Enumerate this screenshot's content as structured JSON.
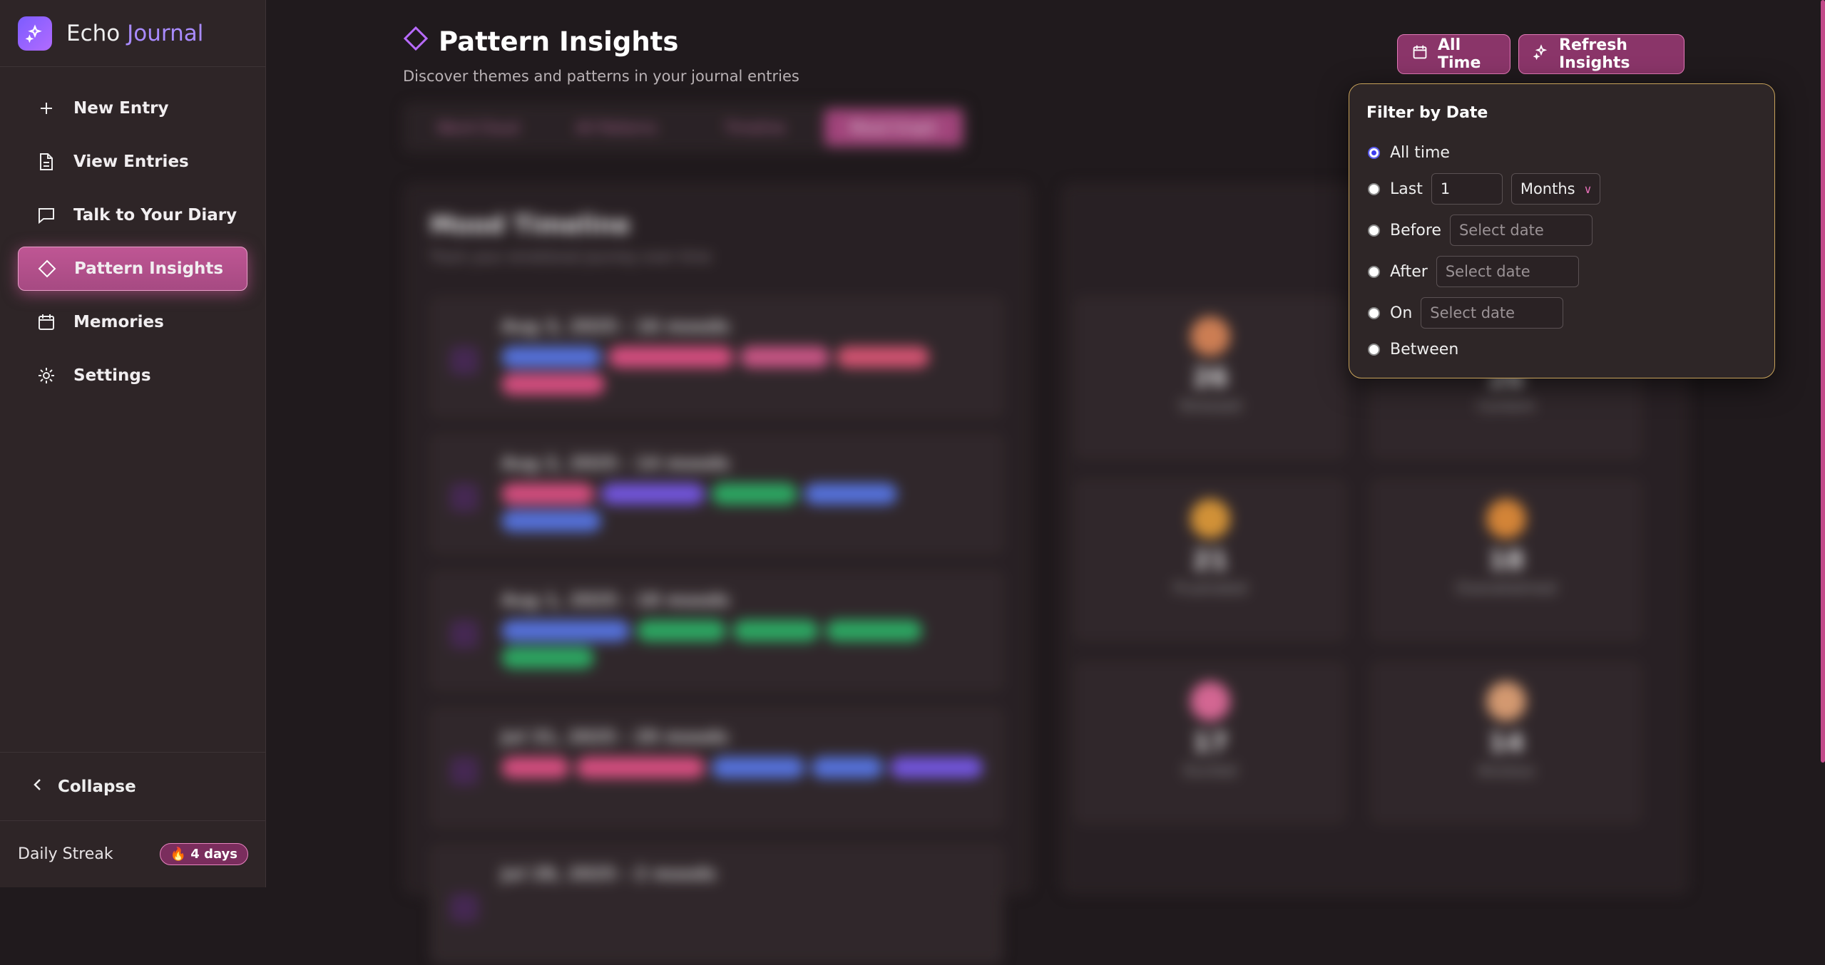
{
  "brand": {
    "name_part1": "Echo",
    "name_part2": "Journal",
    "logo_icon": "sparkles-icon"
  },
  "sidebar": {
    "items": [
      {
        "label": "New Entry",
        "icon": "plus-icon"
      },
      {
        "label": "View Entries",
        "icon": "document-icon"
      },
      {
        "label": "Talk to Your Diary",
        "icon": "chat-icon"
      },
      {
        "label": "Pattern Insights",
        "icon": "diamond-icon",
        "active": true
      },
      {
        "label": "Memories",
        "icon": "calendar-icon"
      },
      {
        "label": "Settings",
        "icon": "gear-icon"
      }
    ],
    "collapse_label": "Collapse",
    "streak_label": "Daily Streak",
    "streak_value": "4 days"
  },
  "header": {
    "title": "Pattern Insights",
    "subtitle": "Discover themes and patterns in your journal entries",
    "all_time_button": "All Time",
    "refresh_button": "Refresh Insights"
  },
  "tabs": [
    "Word Cloud",
    "All Patterns",
    "Timeline",
    "Mood Graph"
  ],
  "mood_timeline": {
    "title": "Mood Timeline",
    "subtitle": "Track your emotional journey over time",
    "rows": [
      {
        "date": "Aug 3, 2025 - 16 moods"
      },
      {
        "date": "Aug 2, 2025 - 14 moods"
      },
      {
        "date": "Aug 1, 2025 - 18 moods"
      },
      {
        "date": "Jul 31, 2025 - 29 moods"
      },
      {
        "date": "Jul 28, 2025 - 2 moods"
      }
    ]
  },
  "mood_stats": [
    {
      "count": "26",
      "label": "Stressed"
    },
    {
      "count": "26",
      "label": "Content"
    },
    {
      "count": "21",
      "label": "Frustrated"
    },
    {
      "count": "18",
      "label": "Overwhelmed"
    },
    {
      "count": "17",
      "label": "Excited"
    },
    {
      "count": "14",
      "label": "Anxious"
    }
  ],
  "filter_popover": {
    "title": "Filter by Date",
    "options": {
      "all_time": "All time",
      "last": "Last",
      "last_value": "1",
      "last_unit": "Months",
      "before": "Before",
      "after": "After",
      "on": "On",
      "between": "Between",
      "date_placeholder": "Select date"
    }
  },
  "colors": {
    "accent": "#b04a86",
    "popover_border": "#c7a25a",
    "radio_checked": "#3d3df0"
  }
}
